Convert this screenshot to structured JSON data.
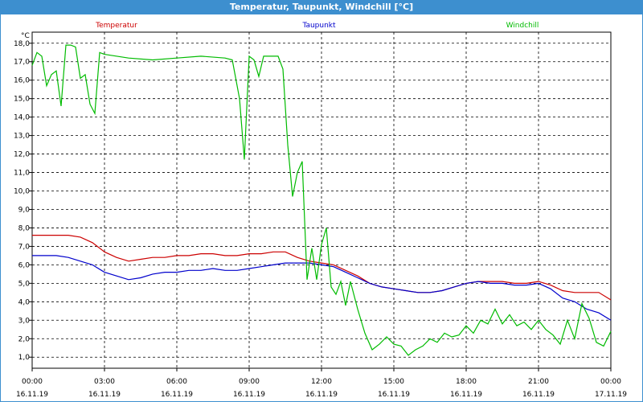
{
  "window": {
    "title": "Temperatur, Taupunkt, Windchill [°C]"
  },
  "chart_data": {
    "type": "line",
    "title": "Temperatur, Taupunkt, Windchill [°C]",
    "ylabel": "°C",
    "ylim": [
      0.4,
      18.6
    ],
    "xlim": [
      0,
      24
    ],
    "y_ticks": [
      "1,0",
      "2,0",
      "3,0",
      "4,0",
      "5,0",
      "6,0",
      "7,0",
      "8,0",
      "9,0",
      "10,0",
      "11,0",
      "12,0",
      "13,0",
      "14,0",
      "15,0",
      "16,0",
      "17,0",
      "18,0"
    ],
    "y_tick_values": [
      1,
      2,
      3,
      4,
      5,
      6,
      7,
      8,
      9,
      10,
      11,
      12,
      13,
      14,
      15,
      16,
      17,
      18
    ],
    "x_ticks": [
      {
        "x": 0,
        "time": "00:00",
        "date": "16.11.19"
      },
      {
        "x": 3,
        "time": "03:00",
        "date": "16.11.19"
      },
      {
        "x": 6,
        "time": "06:00",
        "date": "16.11.19"
      },
      {
        "x": 9,
        "time": "09:00",
        "date": "16.11.19"
      },
      {
        "x": 12,
        "time": "12:00",
        "date": "16.11.19"
      },
      {
        "x": 15,
        "time": "15:00",
        "date": "16.11.19"
      },
      {
        "x": 18,
        "time": "18:00",
        "date": "16.11.19"
      },
      {
        "x": 21,
        "time": "21:00",
        "date": "16.11.19"
      },
      {
        "x": 24,
        "time": "00:00",
        "date": "17.11.19"
      }
    ],
    "grid": true,
    "legend_position": "top",
    "series": [
      {
        "name": "Temperatur",
        "color": "#cc0000",
        "x": [
          0,
          0.5,
          1,
          1.5,
          2,
          2.5,
          3,
          3.5,
          4,
          4.5,
          5,
          5.5,
          6,
          6.5,
          7,
          7.5,
          8,
          8.5,
          9,
          9.5,
          10,
          10.5,
          11,
          11.5,
          12,
          12.5,
          13,
          13.5,
          14,
          14.5,
          15,
          15.5,
          16,
          16.5,
          17,
          17.5,
          18,
          18.5,
          19,
          19.5,
          20,
          20.5,
          21,
          21.5,
          22,
          22.5,
          23,
          23.5,
          24
        ],
        "values": [
          7.6,
          7.6,
          7.6,
          7.6,
          7.5,
          7.2,
          6.7,
          6.4,
          6.2,
          6.3,
          6.4,
          6.4,
          6.5,
          6.5,
          6.6,
          6.6,
          6.5,
          6.5,
          6.6,
          6.6,
          6.7,
          6.7,
          6.4,
          6.2,
          6.1,
          6.0,
          5.7,
          5.4,
          5.0,
          4.8,
          4.7,
          4.6,
          4.5,
          4.5,
          4.6,
          4.8,
          5.0,
          5.1,
          5.1,
          5.1,
          5.0,
          5.0,
          5.1,
          4.9,
          4.6,
          4.5,
          4.5,
          4.5,
          4.1
        ]
      },
      {
        "name": "Taupunkt",
        "color": "#0000cc",
        "x": [
          0,
          0.5,
          1,
          1.5,
          2,
          2.5,
          3,
          3.5,
          4,
          4.5,
          5,
          5.5,
          6,
          6.5,
          7,
          7.5,
          8,
          8.5,
          9,
          9.5,
          10,
          10.5,
          11,
          11.5,
          12,
          12.5,
          13,
          13.5,
          14,
          14.5,
          15,
          15.5,
          16,
          16.5,
          17,
          17.5,
          18,
          18.5,
          19,
          19.5,
          20,
          20.5,
          21,
          21.5,
          22,
          22.5,
          23,
          23.5,
          24
        ],
        "values": [
          6.5,
          6.5,
          6.5,
          6.4,
          6.2,
          6.0,
          5.6,
          5.4,
          5.2,
          5.3,
          5.5,
          5.6,
          5.6,
          5.7,
          5.7,
          5.8,
          5.7,
          5.7,
          5.8,
          5.9,
          6.0,
          6.1,
          6.1,
          6.1,
          6.0,
          5.9,
          5.6,
          5.3,
          5.0,
          4.8,
          4.7,
          4.6,
          4.5,
          4.5,
          4.6,
          4.8,
          5.0,
          5.1,
          5.0,
          5.0,
          4.9,
          4.9,
          5.0,
          4.7,
          4.2,
          4.0,
          3.6,
          3.4,
          3.0
        ]
      },
      {
        "name": "Windchill",
        "color": "#00bb00",
        "x": [
          0,
          0.2,
          0.4,
          0.6,
          0.8,
          1.0,
          1.2,
          1.4,
          1.6,
          1.8,
          2.0,
          2.2,
          2.4,
          2.6,
          2.8,
          3.0,
          4,
          5,
          6,
          7,
          8,
          8.3,
          8.6,
          8.8,
          9.0,
          9.2,
          9.4,
          9.6,
          9.8,
          10.0,
          10.2,
          10.4,
          10.6,
          10.8,
          11.0,
          11.2,
          11.4,
          11.6,
          11.8,
          12.0,
          12.2,
          12.4,
          12.6,
          12.8,
          13.0,
          13.2,
          13.5,
          13.8,
          14.1,
          14.4,
          14.7,
          15.0,
          15.3,
          15.6,
          15.9,
          16.2,
          16.5,
          16.8,
          17.1,
          17.4,
          17.7,
          18.0,
          18.3,
          18.6,
          18.9,
          19.2,
          19.5,
          19.8,
          20.1,
          20.4,
          20.7,
          21.0,
          21.3,
          21.6,
          21.9,
          22.2,
          22.5,
          22.8,
          23.1,
          23.4,
          23.7,
          24.0
        ],
        "values": [
          16.8,
          17.5,
          17.3,
          15.7,
          16.3,
          16.5,
          14.6,
          17.9,
          17.9,
          17.8,
          16.1,
          16.3,
          14.7,
          14.2,
          17.5,
          17.4,
          17.2,
          17.1,
          17.2,
          17.3,
          17.2,
          17.1,
          15.0,
          11.7,
          17.3,
          17.1,
          16.2,
          17.3,
          17.3,
          17.3,
          17.3,
          16.6,
          12.5,
          9.7,
          11.0,
          11.6,
          5.2,
          6.9,
          5.2,
          7.1,
          8.0,
          4.8,
          4.4,
          5.1,
          3.8,
          5.1,
          3.6,
          2.3,
          1.4,
          1.7,
          2.1,
          1.7,
          1.6,
          1.1,
          1.4,
          1.6,
          2.0,
          1.8,
          2.3,
          2.1,
          2.2,
          2.7,
          2.3,
          3.0,
          2.8,
          3.6,
          2.8,
          3.3,
          2.7,
          2.9,
          2.5,
          3.0,
          2.5,
          2.2,
          1.7,
          3.0,
          2.0,
          3.9,
          3.1,
          1.8,
          1.6,
          2.4
        ]
      }
    ]
  }
}
